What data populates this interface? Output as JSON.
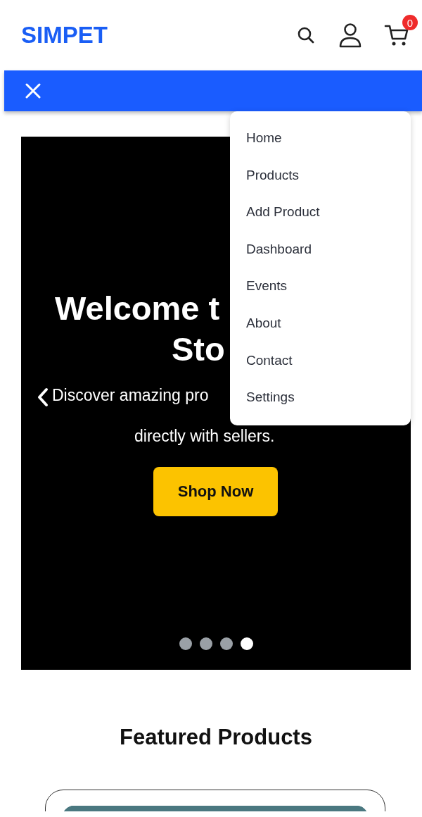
{
  "header": {
    "logo": "SIMPET",
    "cart_count": "0"
  },
  "menu": {
    "items": [
      "Home",
      "Products",
      "Add Product",
      "Dashboard",
      "Events",
      "About",
      "Contact",
      "Settings"
    ]
  },
  "hero": {
    "title_lines": [
      "Welcome t",
      "Sto"
    ],
    "subtitle_lines": [
      "Discover amazing pro",
      "directly with sellers."
    ],
    "button": "Shop Now",
    "slides": [
      {
        "selected": false
      },
      {
        "selected": false
      },
      {
        "selected": false
      },
      {
        "selected": true
      }
    ]
  },
  "featured": {
    "heading": "Featured Products"
  }
}
